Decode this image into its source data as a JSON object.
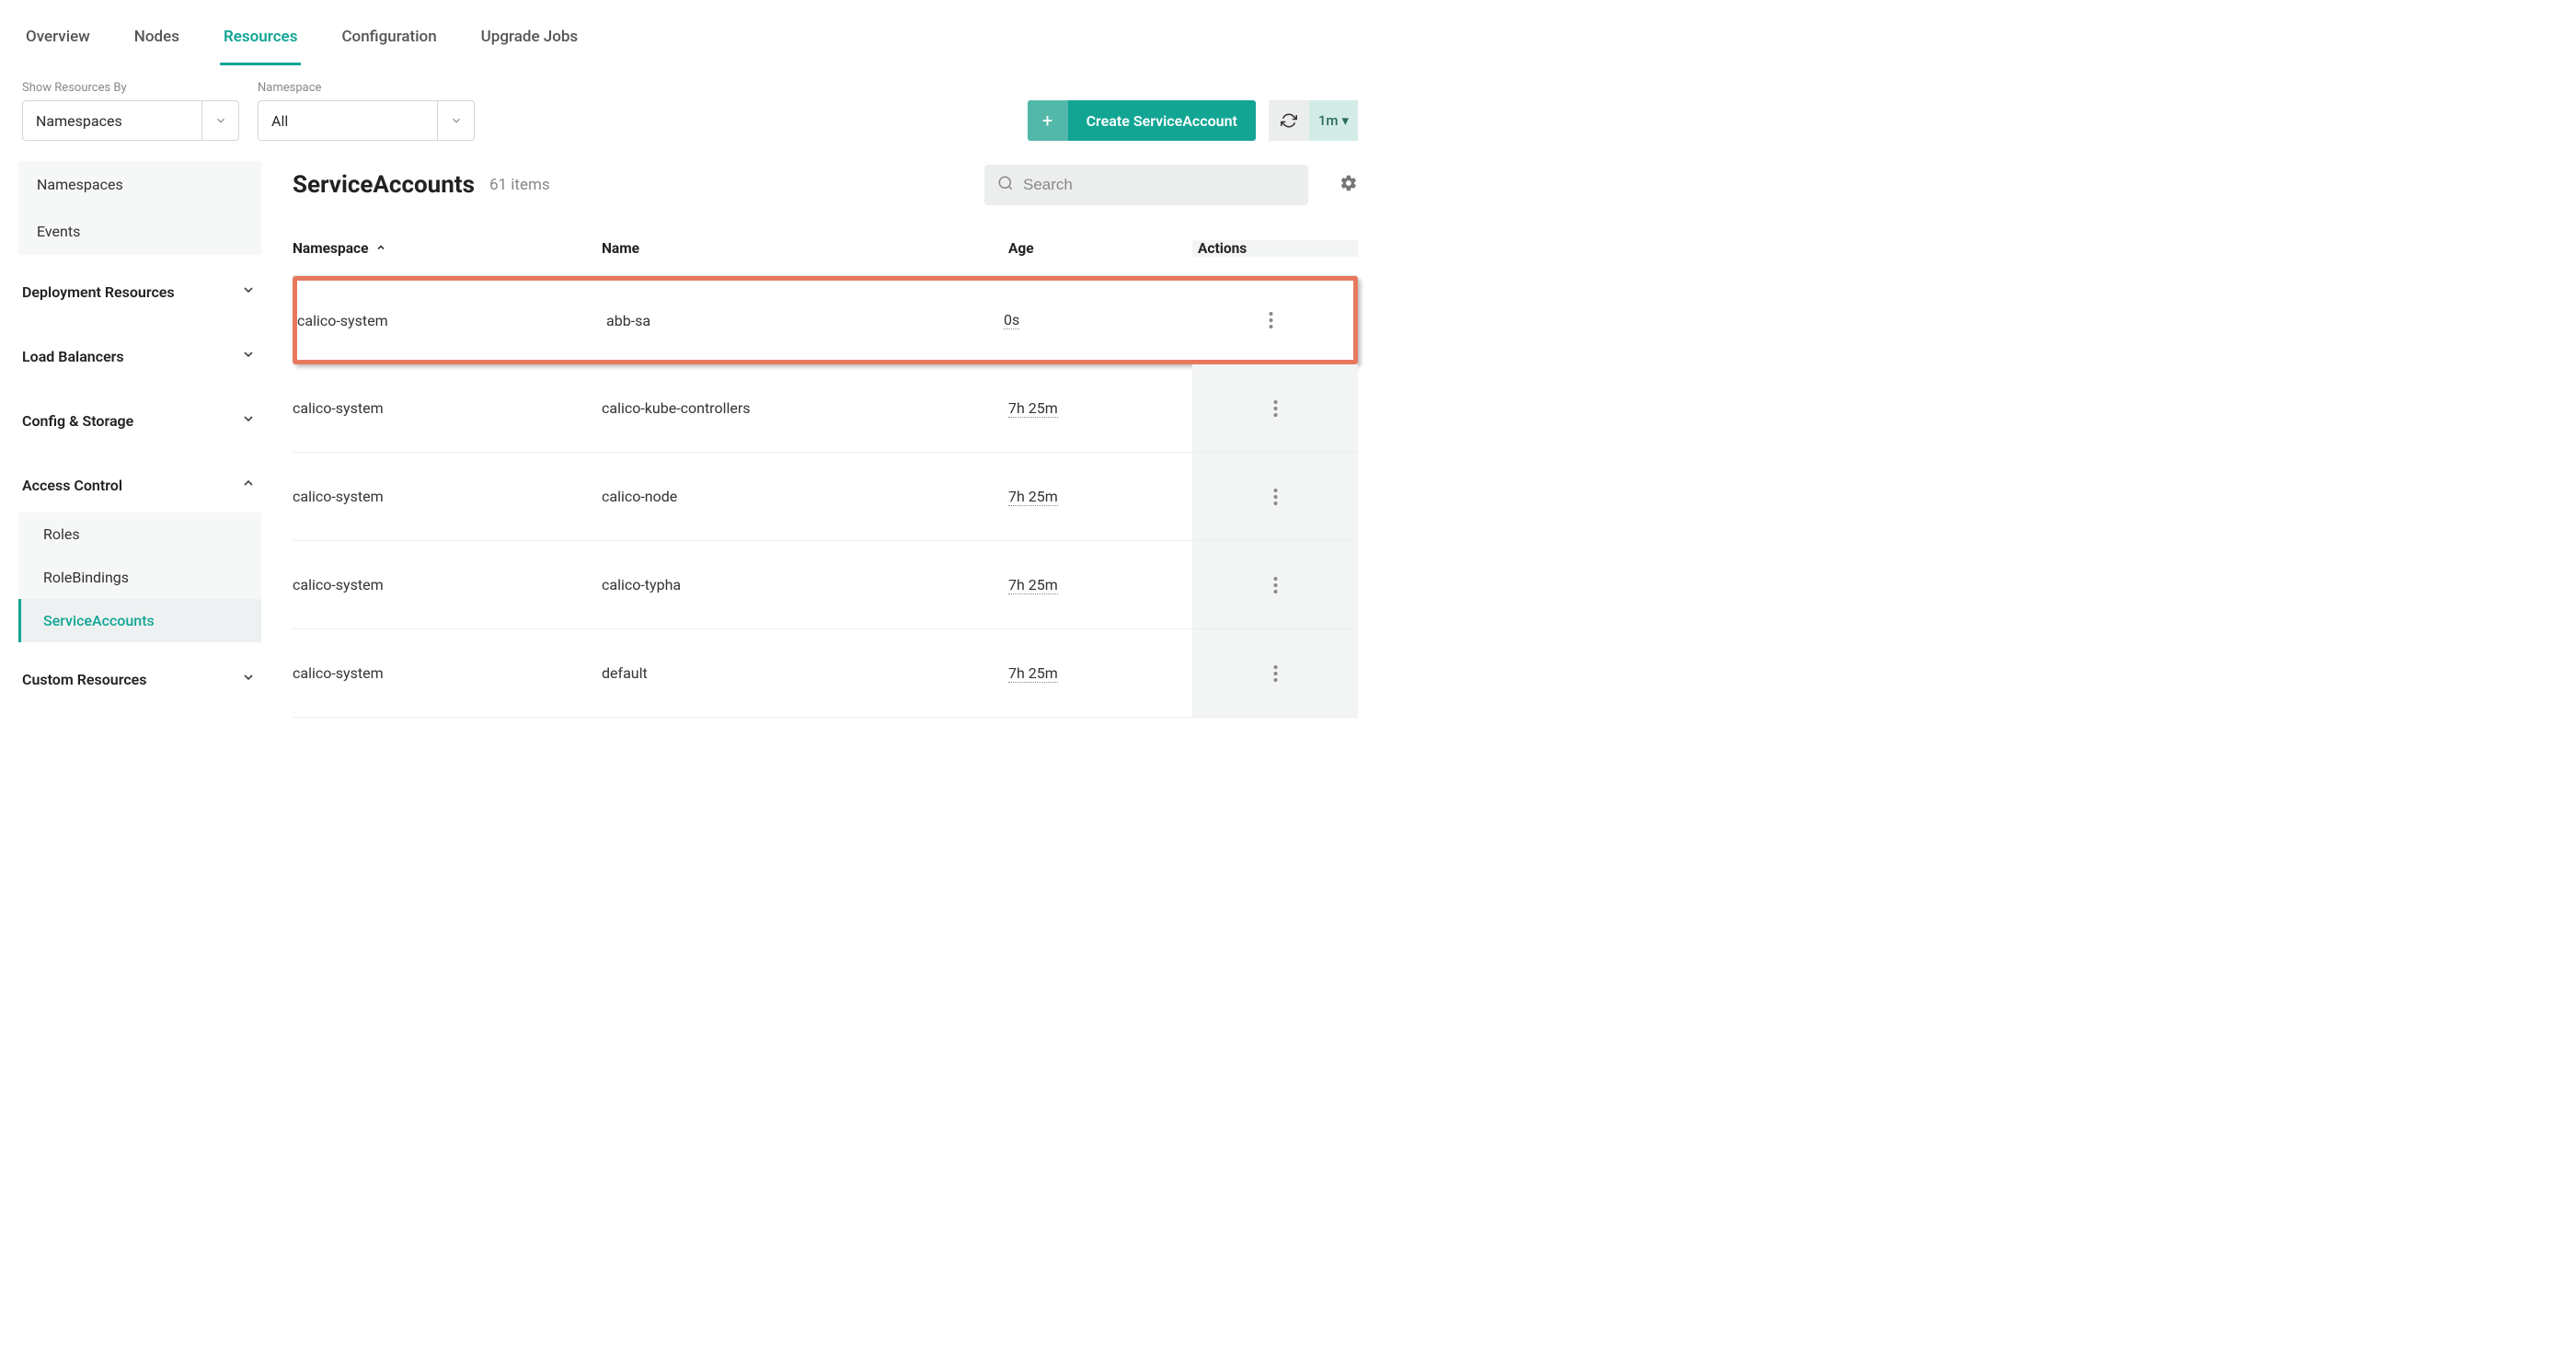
{
  "tabs": [
    {
      "label": "Overview",
      "active": false
    },
    {
      "label": "Nodes",
      "active": false
    },
    {
      "label": "Resources",
      "active": true
    },
    {
      "label": "Configuration",
      "active": false
    },
    {
      "label": "Upgrade Jobs",
      "active": false
    }
  ],
  "filters": {
    "show_by_label": "Show Resources By",
    "show_by_value": "Namespaces",
    "namespace_label": "Namespace",
    "namespace_value": "All"
  },
  "actions": {
    "create_label": "Create ServiceAccount",
    "refresh_interval": "1m"
  },
  "sidebar": {
    "panel_items": [
      {
        "label": "Namespaces"
      },
      {
        "label": "Events"
      }
    ],
    "groups": [
      {
        "label": "Deployment Resources",
        "expanded": false
      },
      {
        "label": "Load Balancers",
        "expanded": false
      },
      {
        "label": "Config & Storage",
        "expanded": false
      },
      {
        "label": "Access Control",
        "expanded": true,
        "children": [
          {
            "label": "Roles",
            "active": false
          },
          {
            "label": "RoleBindings",
            "active": false
          },
          {
            "label": "ServiceAccounts",
            "active": true
          }
        ]
      },
      {
        "label": "Custom Resources",
        "expanded": false
      }
    ]
  },
  "main": {
    "title": "ServiceAccounts",
    "count_label": "61 items",
    "search_placeholder": "Search",
    "columns": {
      "namespace": "Namespace",
      "name": "Name",
      "age": "Age",
      "actions": "Actions"
    },
    "rows": [
      {
        "namespace": "calico-system",
        "name": "abb-sa",
        "age": "0s",
        "highlighted": true
      },
      {
        "namespace": "calico-system",
        "name": "calico-kube-controllers",
        "age": "7h 25m",
        "highlighted": false
      },
      {
        "namespace": "calico-system",
        "name": "calico-node",
        "age": "7h 25m",
        "highlighted": false
      },
      {
        "namespace": "calico-system",
        "name": "calico-typha",
        "age": "7h 25m",
        "highlighted": false
      },
      {
        "namespace": "calico-system",
        "name": "default",
        "age": "7h 25m",
        "highlighted": false
      }
    ]
  }
}
